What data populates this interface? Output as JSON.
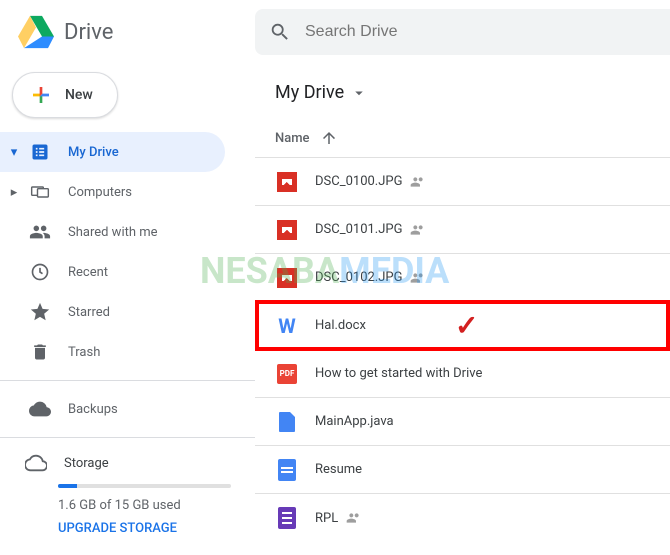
{
  "header": {
    "app_name": "Drive",
    "search_placeholder": "Search Drive"
  },
  "sidebar": {
    "new_label": "New",
    "nav": [
      {
        "label": "My Drive",
        "icon": "drive",
        "active": true,
        "expandable": true,
        "expanded": true
      },
      {
        "label": "Computers",
        "icon": "computers",
        "active": false,
        "expandable": true,
        "expanded": false
      },
      {
        "label": "Shared with me",
        "icon": "people",
        "active": false,
        "expandable": false
      },
      {
        "label": "Recent",
        "icon": "clock",
        "active": false,
        "expandable": false
      },
      {
        "label": "Starred",
        "icon": "star",
        "active": false,
        "expandable": false
      },
      {
        "label": "Trash",
        "icon": "trash",
        "active": false,
        "expandable": false
      }
    ],
    "backups_label": "Backups",
    "storage": {
      "label": "Storage",
      "used_text": "1.6 GB of 15 GB used",
      "upgrade_label": "UPGRADE STORAGE",
      "percent": 11
    }
  },
  "main": {
    "breadcrumb_label": "My Drive",
    "column_name": "Name",
    "sort_direction": "asc",
    "files": [
      {
        "name": "DSC_0100.JPG",
        "type": "image",
        "shared": true,
        "highlighted": false
      },
      {
        "name": "DSC_0101.JPG",
        "type": "image",
        "shared": true,
        "highlighted": false
      },
      {
        "name": "DSC_0102.JPG",
        "type": "image",
        "shared": true,
        "highlighted": false
      },
      {
        "name": "Hal.docx",
        "type": "word",
        "shared": false,
        "highlighted": true
      },
      {
        "name": "How to get started with Drive",
        "type": "pdf",
        "shared": false,
        "highlighted": false
      },
      {
        "name": "MainApp.java",
        "type": "file",
        "shared": false,
        "highlighted": false
      },
      {
        "name": "Resume",
        "type": "doc",
        "shared": false,
        "highlighted": false
      },
      {
        "name": "RPL",
        "type": "form",
        "shared": true,
        "highlighted": false
      }
    ]
  },
  "annotations": {
    "watermark_part1": "NESABA",
    "watermark_part2": "MEDIA"
  }
}
